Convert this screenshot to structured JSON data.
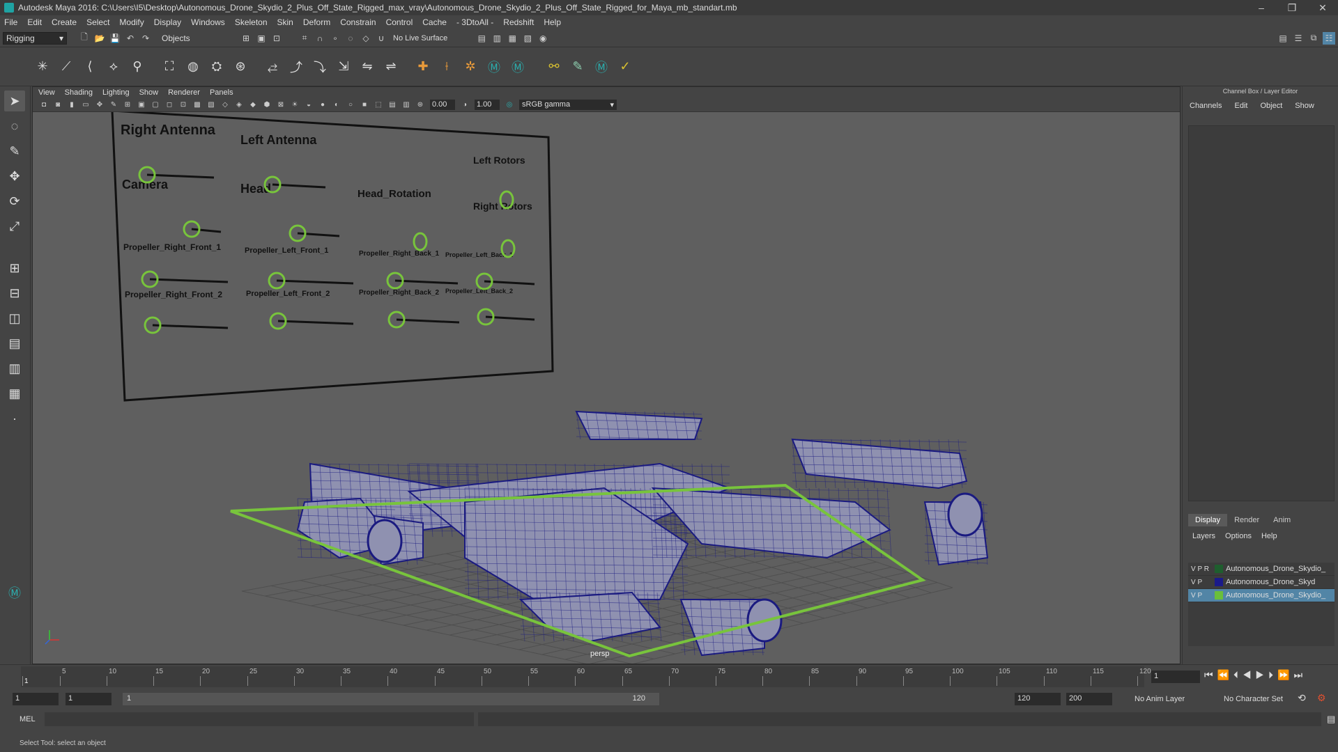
{
  "window": {
    "title": "Autodesk Maya 2016: C:\\Users\\I5\\Desktop\\Autonomous_Drone_Skydio_2_Plus_Off_State_Rigged_max_vray\\Autonomous_Drone_Skydio_2_Plus_Off_State_Rigged_for_Maya_mb_standart.mb",
    "minimize": "–",
    "restore": "❐",
    "close": "✕"
  },
  "menubar": [
    "File",
    "Edit",
    "Create",
    "Select",
    "Modify",
    "Display",
    "Windows",
    "Skeleton",
    "Skin",
    "Deform",
    "Constrain",
    "Control",
    "Cache",
    "- 3DtoAll -",
    "Redshift",
    "Help"
  ],
  "statusline": {
    "mode": "Rigging",
    "selection_mask": "Objects",
    "live_surface": "No Live Surface"
  },
  "viewport": {
    "menu": [
      "View",
      "Shading",
      "Lighting",
      "Show",
      "Renderer",
      "Panels"
    ],
    "near": "0.00",
    "far": "1.00",
    "color_space": "sRGB gamma",
    "camera": "persp"
  },
  "rig_panel": {
    "labels": [
      "Right Antenna",
      "Left Antenna",
      "Left Rotors",
      "Camera",
      "Head",
      "Head_Rotation",
      "Right Rotors",
      "Propeller_Right_Front_1",
      "Propeller_Left_Front_1",
      "Propeller_Right_Back_1",
      "Propeller_Left_Back_1",
      "Propeller_Right_Front_2",
      "Propeller_Left_Front_2",
      "Propeller_Right_Back_2",
      "Propeller_Left_Back_2"
    ]
  },
  "channelbox": {
    "title": "Channel Box / Layer Editor",
    "menu": [
      "Channels",
      "Edit",
      "Object",
      "Show"
    ],
    "tabs": [
      "Display",
      "Render",
      "Anim"
    ],
    "layer_menu": [
      "Layers",
      "Options",
      "Help"
    ],
    "layers": [
      {
        "flags": "V P R",
        "name": "Autonomous_Drone_Skydio_",
        "color": "#1e5e2e"
      },
      {
        "flags": "V  P",
        "name": "Autonomous_Drone_Skyd",
        "color": "#1a1a8a"
      },
      {
        "flags": "V P",
        "name": "Autonomous_Drone_Skydio_",
        "color": "#6abf3a"
      }
    ]
  },
  "timeslider": {
    "ticks": [
      "1",
      "5",
      "10",
      "15",
      "20",
      "25",
      "30",
      "35",
      "40",
      "45",
      "50",
      "55",
      "60",
      "65",
      "70",
      "75",
      "80",
      "85",
      "90",
      "95",
      "100",
      "105",
      "110",
      "115",
      "120"
    ],
    "current_frame": "1"
  },
  "range": {
    "start": "1",
    "playback_start": "1",
    "slider_start": "1",
    "slider_end": "120",
    "playback_end": "120",
    "end": "200",
    "anim_layer": "No Anim Layer",
    "character_set": "No Character Set"
  },
  "cmdline": {
    "lang": "MEL"
  },
  "helpline": "Select Tool: select an object"
}
